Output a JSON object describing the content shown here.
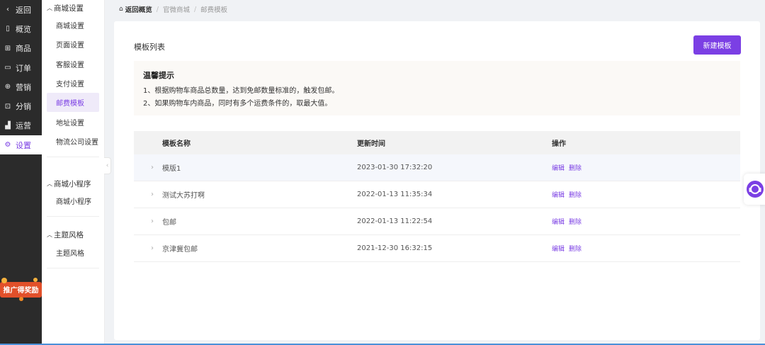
{
  "nav": {
    "items": [
      {
        "icon": "chevron-left-icon",
        "glyph": "‹",
        "label": "返回"
      },
      {
        "icon": "overview-icon",
        "glyph": "▯",
        "label": "概览"
      },
      {
        "icon": "goods-icon",
        "glyph": "⊞",
        "label": "商品"
      },
      {
        "icon": "order-icon",
        "glyph": "▭",
        "label": "订单"
      },
      {
        "icon": "marketing-icon",
        "glyph": "⊕",
        "label": "营销"
      },
      {
        "icon": "distribution-icon",
        "glyph": "⊡",
        "label": "分销"
      },
      {
        "icon": "operations-icon",
        "glyph": "▟",
        "label": "运营"
      },
      {
        "icon": "gear-icon",
        "glyph": "⚙",
        "label": "设置"
      }
    ],
    "active_index": 7,
    "promo_text": "推广得奖励"
  },
  "submenu": {
    "groups": [
      {
        "title": "商城设置",
        "items": [
          "商城设置",
          "页面设置",
          "客服设置",
          "支付设置",
          "邮费模板",
          "地址设置",
          "物流公司设置"
        ]
      },
      {
        "title": "商城小程序",
        "items": [
          "商城小程序"
        ]
      },
      {
        "title": "主题风格",
        "items": [
          "主题风格"
        ]
      }
    ],
    "active_item": "邮费模板"
  },
  "breadcrumb": {
    "home": "返回概览",
    "items": [
      "官微商城",
      "邮费模板"
    ]
  },
  "card": {
    "title": "模板列表",
    "new_button": "新建模板"
  },
  "tips": {
    "title": "温馨提示",
    "lines": [
      "1、根据购物车商品总数量，达到免邮数量标准的，触发包邮。",
      "2、如果购物车内商品，同时有多个运费条件的，取最大值。"
    ]
  },
  "table": {
    "columns": [
      "模板名称",
      "更新时间",
      "操作"
    ],
    "rows": [
      {
        "name": "模版1",
        "time": "2023-01-30 17:32:20"
      },
      {
        "name": "测试大苏打啊",
        "time": "2022-01-13 11:35:34"
      },
      {
        "name": "包邮",
        "time": "2022-01-13 11:22:54"
      },
      {
        "name": "京津冀包邮",
        "time": "2021-12-30 16:32:15"
      }
    ],
    "ops": {
      "edit": "编辑",
      "delete": "删除"
    }
  },
  "colors": {
    "accent": "#7b3fe4",
    "sidebar": "#2b2b2b"
  }
}
